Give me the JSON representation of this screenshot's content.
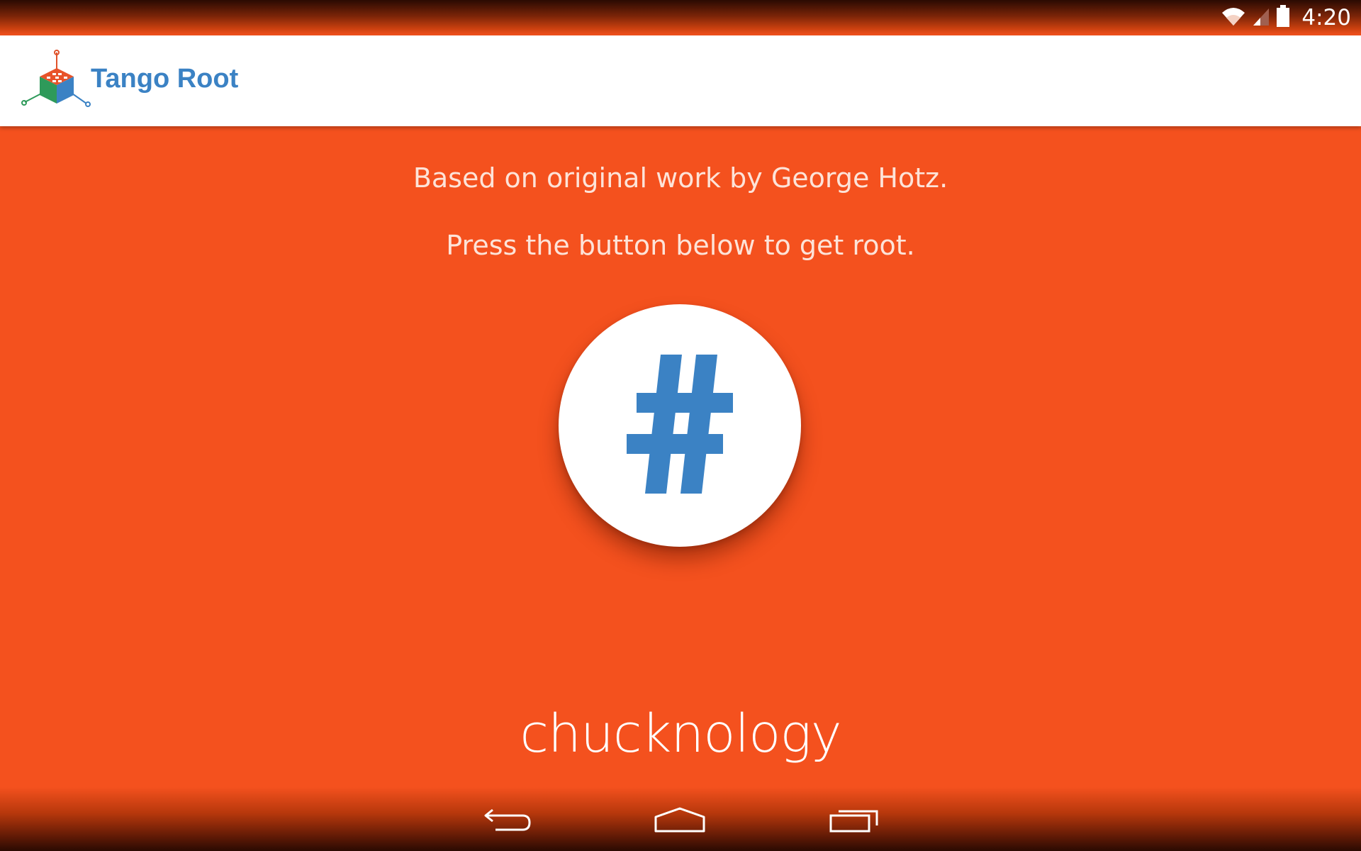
{
  "status_bar": {
    "time": "4:20",
    "icons": [
      "wifi-icon",
      "signal-icon",
      "battery-icon"
    ]
  },
  "action_bar": {
    "title": "Tango Root",
    "logo": "tango-cube-logo"
  },
  "content": {
    "line1": "Based on original work by George Hotz.",
    "line2": "Press the button below to get root.",
    "button_icon": "hash-icon",
    "brand": "chucknology"
  },
  "nav_bar": {
    "buttons": [
      "back-icon",
      "home-icon",
      "recents-icon"
    ]
  },
  "colors": {
    "background": "#f4511e",
    "accent_blue": "#3b82c4",
    "action_bar": "#ffffff"
  }
}
